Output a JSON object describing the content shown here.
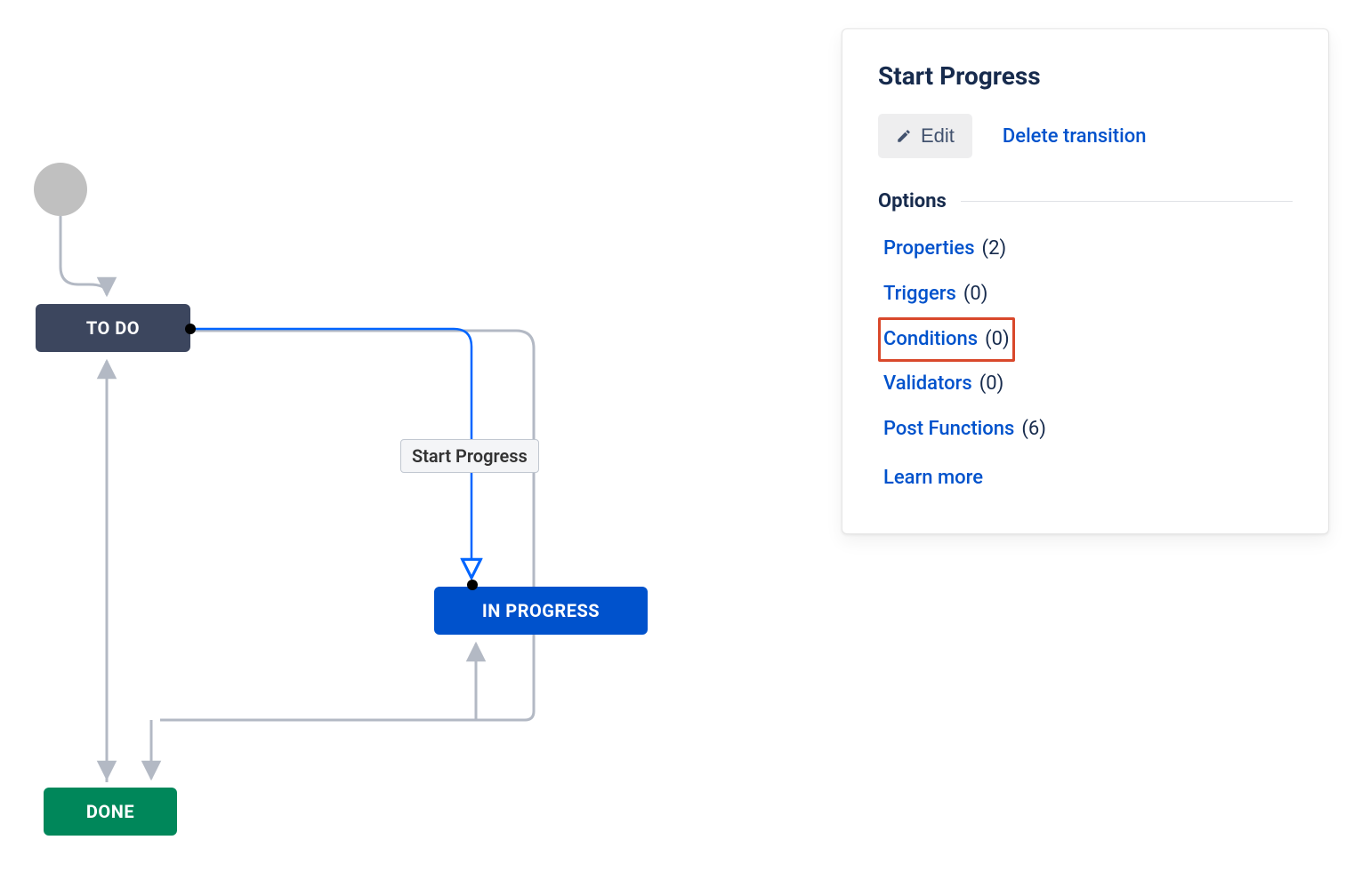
{
  "diagram": {
    "start_node": "start",
    "nodes": {
      "todo": {
        "label": "TO DO"
      },
      "inprogress": {
        "label": "IN PROGRESS"
      },
      "done": {
        "label": "DONE"
      }
    },
    "transition_label": "Start Progress"
  },
  "panel": {
    "title": "Start Progress",
    "edit_label": "Edit",
    "delete_label": "Delete transition",
    "options_header": "Options",
    "options": [
      {
        "key": "properties",
        "label": "Properties",
        "count": 2,
        "highlighted": false
      },
      {
        "key": "triggers",
        "label": "Triggers",
        "count": 0,
        "highlighted": false
      },
      {
        "key": "conditions",
        "label": "Conditions",
        "count": 0,
        "highlighted": true
      },
      {
        "key": "validators",
        "label": "Validators",
        "count": 0,
        "highlighted": false
      },
      {
        "key": "post_functions",
        "label": "Post Functions",
        "count": 6,
        "highlighted": false
      }
    ],
    "learn_more": "Learn more"
  }
}
